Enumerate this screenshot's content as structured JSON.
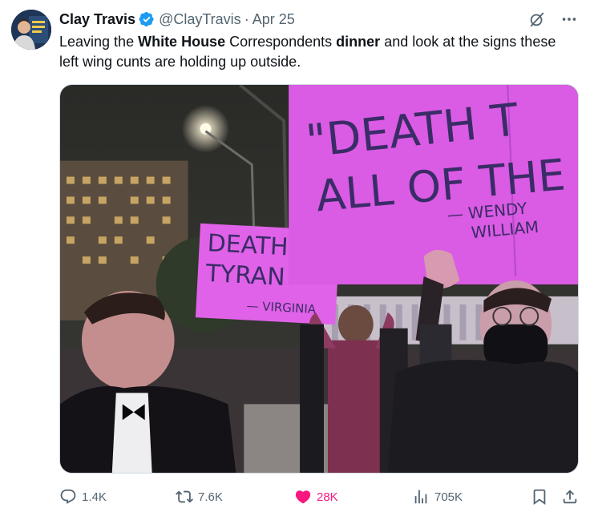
{
  "author": {
    "name": "Clay Travis",
    "handle": "@ClayTravis",
    "separator": "·",
    "date": "Apr 25",
    "avatar_icon": "avatar-image",
    "verified_color": "#1d9bf0"
  },
  "tweet": {
    "text_1": "Leaving the ",
    "text_bold_1": "White House",
    "text_2": " Correspondents ",
    "text_bold_2": "dinner",
    "text_3": " and look at the signs these left wing cunts are holding up outside."
  },
  "media": {
    "sign_left_line1": "DEATH",
    "sign_left_line2": "TYRAN",
    "sign_left_attribution": "— VIRGINIA",
    "sign_right_line1": "\"DEATH T",
    "sign_right_line2": "ALL OF THE",
    "sign_right_attribution_1": "— WENDY",
    "sign_right_attribution_2": "WILLIAM"
  },
  "actions": {
    "replies": "1.4K",
    "retweets": "7.6K",
    "likes": "28K",
    "views": "705K",
    "like_color": "#f91880",
    "muted_color": "#536471"
  },
  "icons": {
    "grok": "grok-icon",
    "more": "more-icon",
    "reply": "reply-icon",
    "retweet": "retweet-icon",
    "like": "heart-icon",
    "views": "views-icon",
    "bookmark": "bookmark-icon",
    "share": "share-icon"
  }
}
